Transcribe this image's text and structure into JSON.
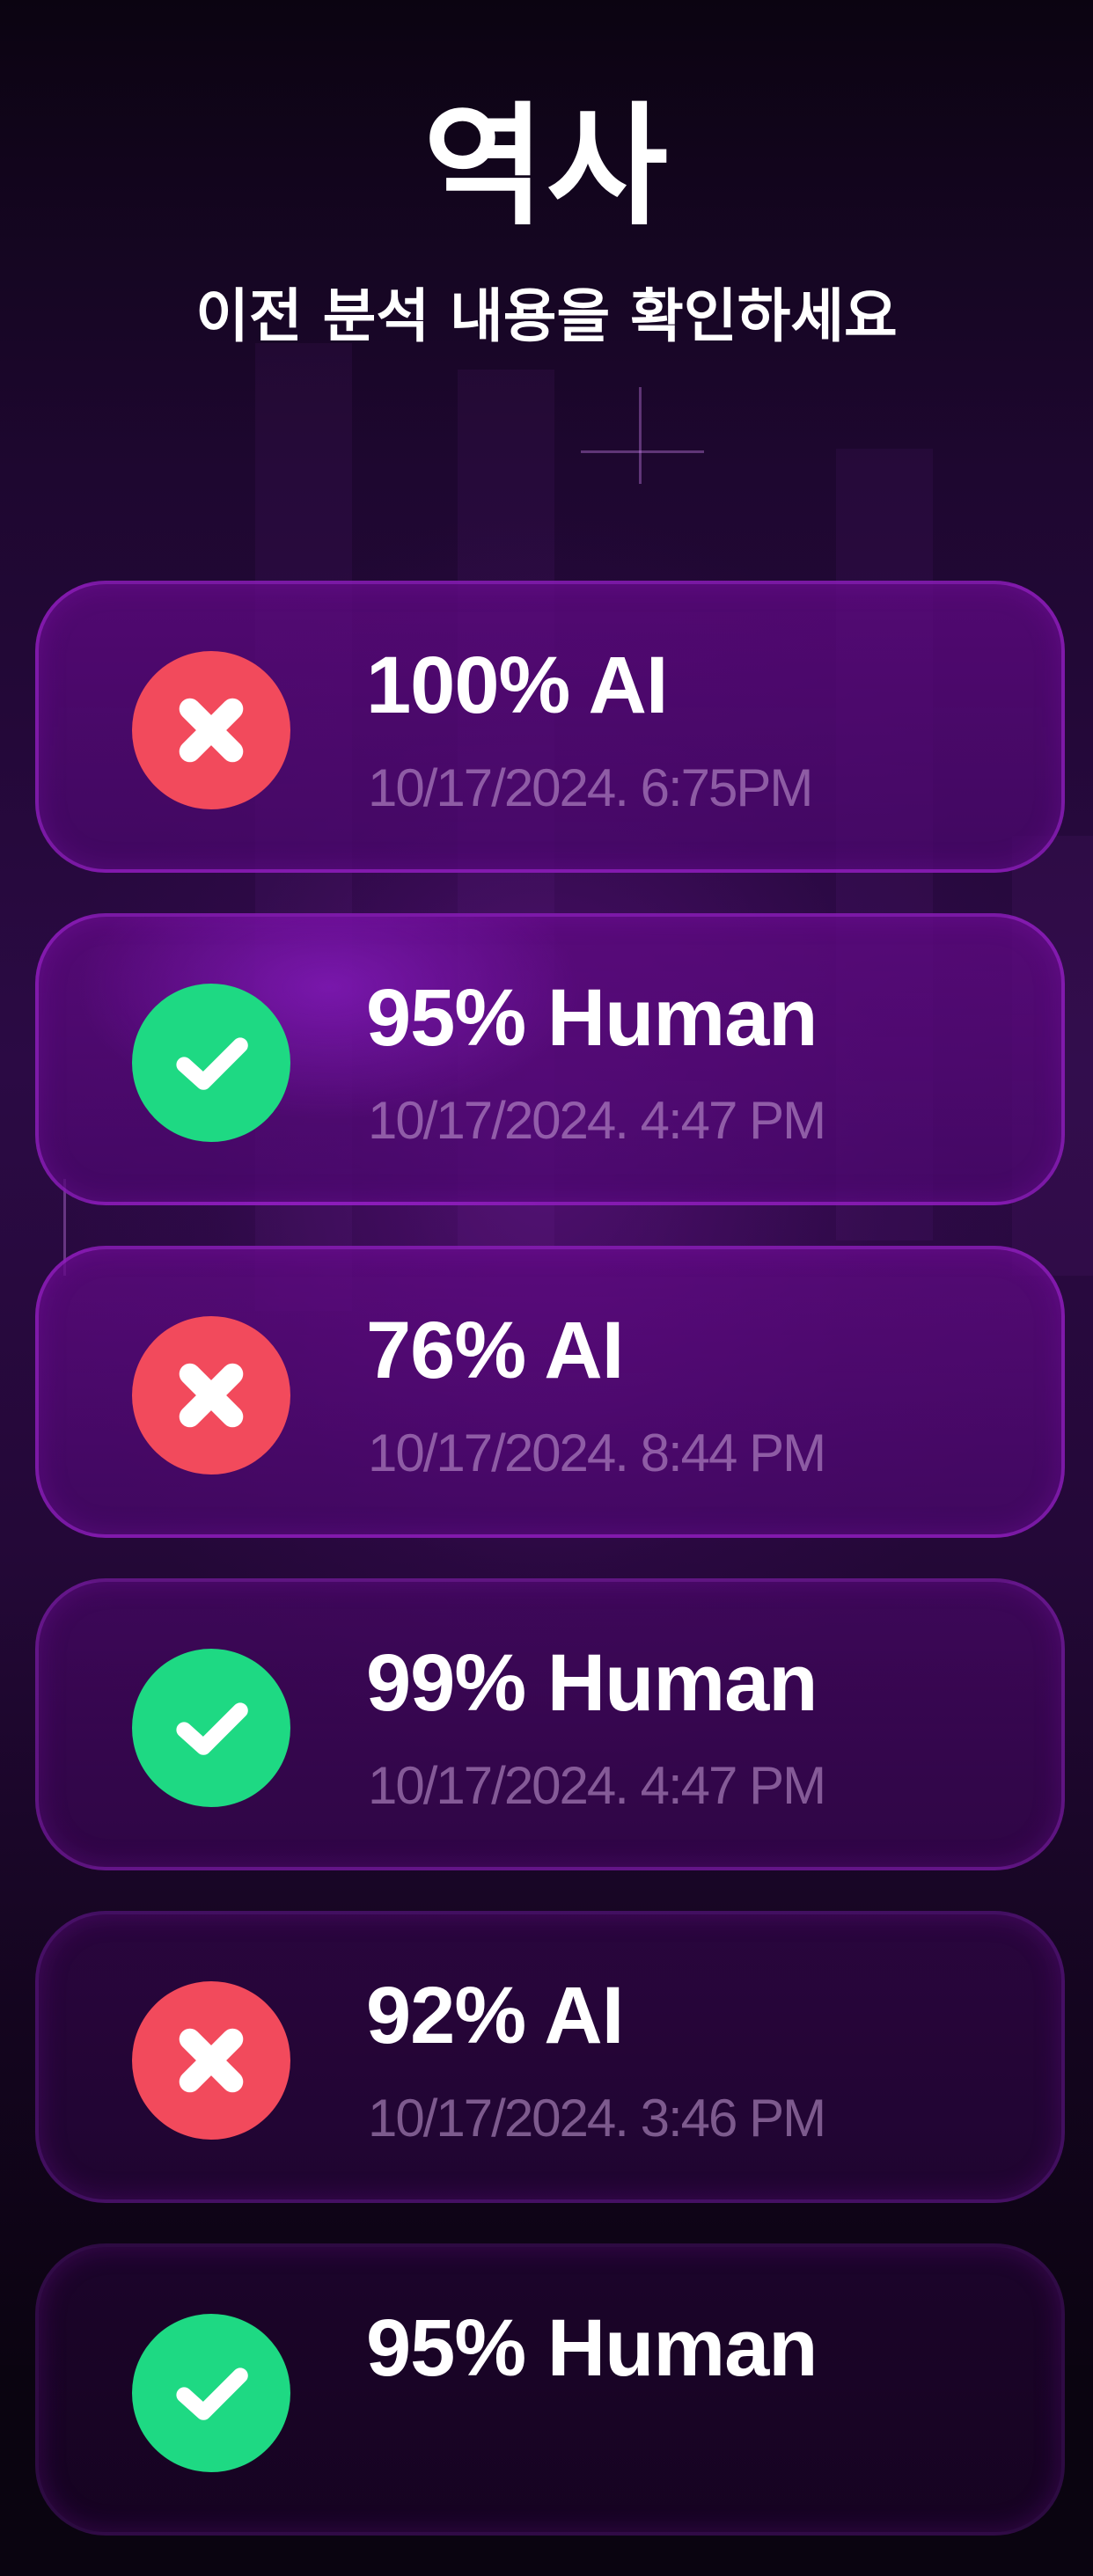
{
  "header": {
    "title": "역사",
    "subtitle": "이전 분석 내용을 확인하세요"
  },
  "colors": {
    "ai_icon": "#f24a5c",
    "human_icon": "#1ed983",
    "card_border": "#a828dc",
    "background": "#0a0410"
  },
  "history": [
    {
      "result": "100% AI",
      "date": "10/17/2024. 6:75PM",
      "type": "ai",
      "icon": "x-icon"
    },
    {
      "result": "95% Human",
      "date": "10/17/2024. 4:47 PM",
      "type": "human",
      "icon": "check-icon"
    },
    {
      "result": "76% AI",
      "date": "10/17/2024. 8:44 PM",
      "type": "ai",
      "icon": "x-icon"
    },
    {
      "result": "99% Human",
      "date": "10/17/2024. 4:47 PM",
      "type": "human",
      "icon": "check-icon"
    },
    {
      "result": "92% AI",
      "date": "10/17/2024. 3:46 PM",
      "type": "ai",
      "icon": "x-icon"
    },
    {
      "result": "95% Human",
      "date": "",
      "type": "human",
      "icon": "check-icon"
    }
  ]
}
